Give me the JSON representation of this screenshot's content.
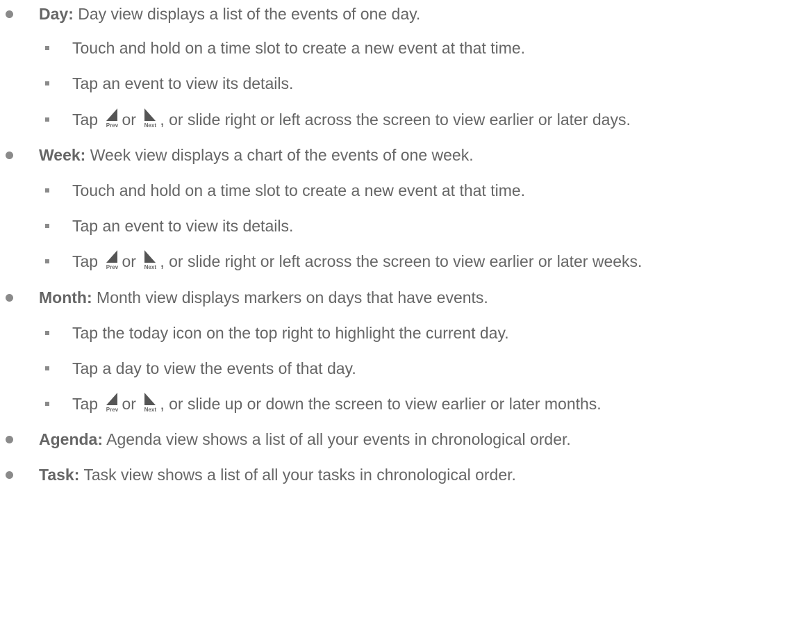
{
  "items": [
    {
      "term": "Day:",
      "text": "Day view displays a list of the events of one day.",
      "subs": [
        "Touch and hold on a time slot to create a new event at that time.",
        "Tap an event to view its details."
      ],
      "nav": {
        "before": "Tap",
        "mid": "or",
        "after": ", or slide right or left across the screen to view earlier or later days."
      }
    },
    {
      "term": "Week:",
      "text": "Week view displays a chart of the events of one week.",
      "subs": [
        "Touch and hold on a time slot to create a new event at that time.",
        "Tap an event to view its details."
      ],
      "nav": {
        "before": "Tap",
        "mid": "or",
        "after": ", or slide right or left across the screen to view earlier or later weeks."
      }
    },
    {
      "term": "Month:",
      "text": "Month view displays markers on days that have events.",
      "subs": [
        "Tap the today icon on the top right to highlight the current day.",
        "Tap a day to view the events of that day."
      ],
      "nav": {
        "before": "Tap",
        "mid": "or",
        "after": ", or slide up or down the screen to view earlier or later months."
      }
    },
    {
      "term": "Agenda:",
      "text": "Agenda view shows a list of all your events in chronological order."
    },
    {
      "term": "Task:",
      "text": "Task view shows a list of all your tasks in chronological order."
    }
  ],
  "icons": {
    "prev": {
      "name": "prev-arrow-icon",
      "caption": "Prev"
    },
    "next": {
      "name": "next-arrow-icon",
      "caption": "Next"
    }
  },
  "colors": {
    "text": "#666666",
    "bullet": "#8a8a8a",
    "icon": "#555555"
  }
}
